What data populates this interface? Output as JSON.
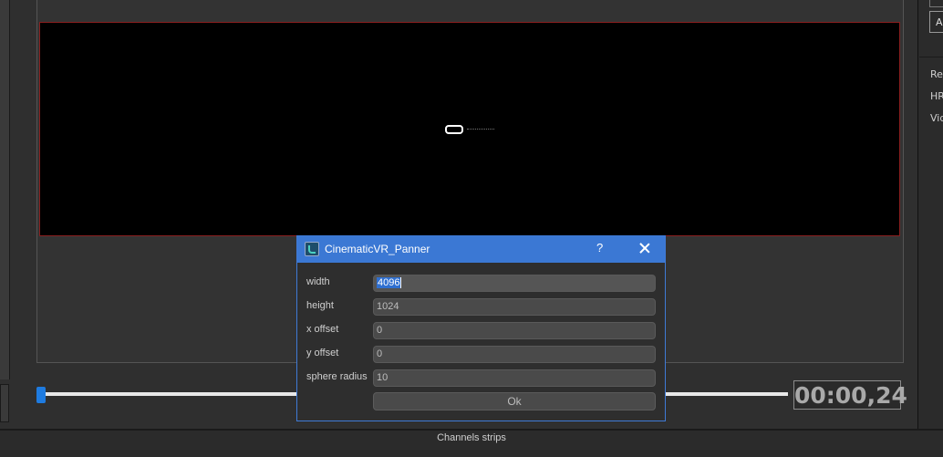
{
  "dialog": {
    "title": "CinematicVR_Panner",
    "help_label": "?",
    "fields": [
      {
        "label": "width",
        "value": "4096"
      },
      {
        "label": "height",
        "value": "1024"
      },
      {
        "label": "x offset",
        "value": "0"
      },
      {
        "label": "y offset",
        "value": "0"
      },
      {
        "label": "sphere radius",
        "value": "10"
      }
    ],
    "ok_label": "Ok"
  },
  "timeline": {
    "timecode": "00:00,24",
    "position_fraction": 0.0
  },
  "right_panel": {
    "dropdown_label": "A",
    "labels": [
      "Re",
      "HR",
      "Vid"
    ]
  },
  "bottom": {
    "label": "Channels strips"
  },
  "colors": {
    "accent": "#3b78d4",
    "timeline_handle": "#1e7be0",
    "video_border": "#8a1f1f"
  }
}
